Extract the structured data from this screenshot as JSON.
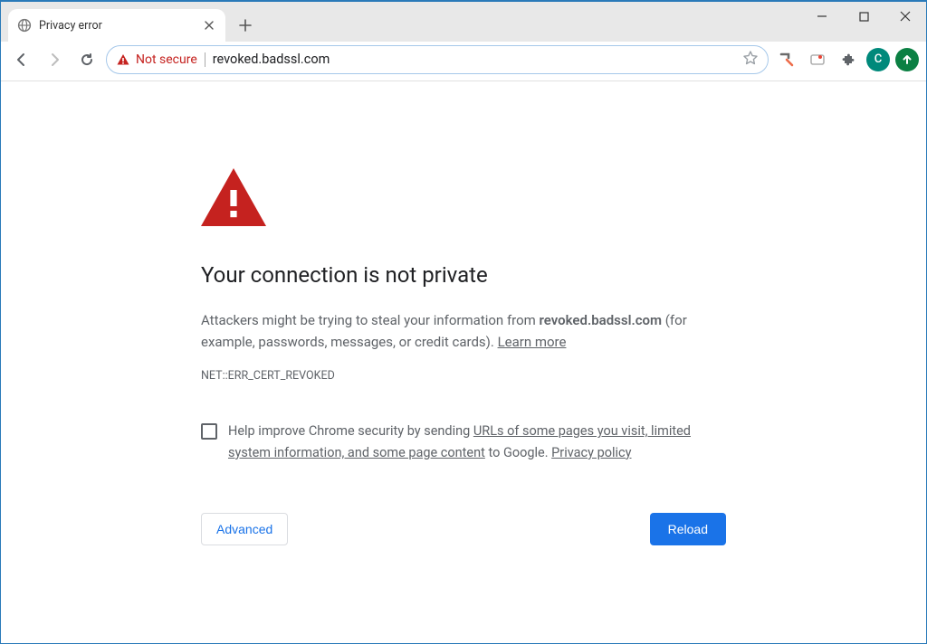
{
  "window": {
    "tab_title": "Privacy error",
    "security_label": "Not secure",
    "url": "revoked.badssl.com",
    "avatar_letter": "C"
  },
  "page": {
    "heading": "Your connection is not private",
    "explain_pre": "Attackers might be trying to steal your information from ",
    "explain_host": "revoked.badssl.com",
    "explain_post": " (for example, passwords, messages, or credit cards). ",
    "learn_more": "Learn more",
    "error_code": "NET::ERR_CERT_REVOKED",
    "optin_pre": "Help improve Chrome security by sending ",
    "optin_link1": "URLs of some pages you visit, limited system information, and some page content",
    "optin_mid": " to Google. ",
    "optin_link2": "Privacy policy",
    "advanced": "Advanced",
    "reload": "Reload"
  },
  "colors": {
    "danger": "#c5221f",
    "primary": "#1a73e8"
  }
}
